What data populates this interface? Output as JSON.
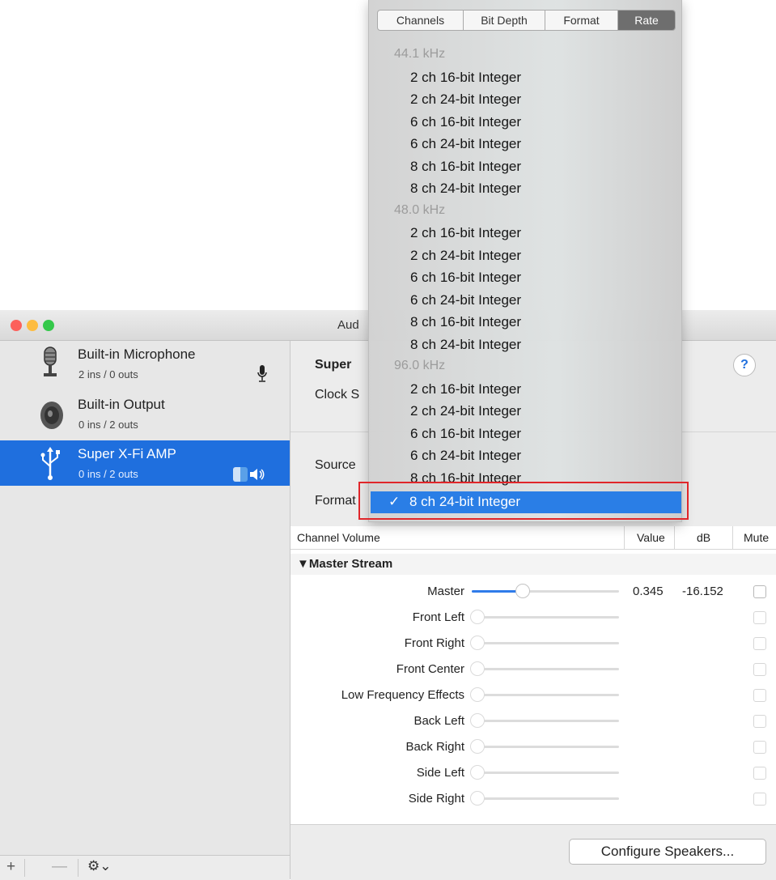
{
  "window": {
    "title": "Aud",
    "traffic_lights": [
      "#fc605b",
      "#fdbc40",
      "#34c84a"
    ]
  },
  "sidebar": {
    "devices": [
      {
        "name": "Built-in Microphone",
        "io": "2 ins / 0 outs",
        "icon": "microphone-icon",
        "badge": "mic-small-icon"
      },
      {
        "name": "Built-in Output",
        "io": "0 ins / 2 outs",
        "icon": "speaker-icon"
      },
      {
        "name": "Super X-Fi AMP",
        "io": "0 ins / 2 outs",
        "icon": "usb-icon",
        "selected": true,
        "badge": "finder-speaker-icon"
      }
    ],
    "footer": {
      "add": "+",
      "remove": "—",
      "gear": "⚙⌄"
    }
  },
  "detail": {
    "device_title": "Super",
    "clock_label": "Clock S",
    "source_label": "Source",
    "format_label": "Format",
    "help": "?"
  },
  "table": {
    "headers": {
      "channel": "Channel Volume",
      "value": "Value",
      "db": "dB",
      "mute": "Mute"
    },
    "group": "▼Master Stream",
    "rows": [
      {
        "label": "Master",
        "value": "0.345",
        "db": "-16.152",
        "level": 0.345,
        "active": true
      },
      {
        "label": "Front Left"
      },
      {
        "label": "Front Right"
      },
      {
        "label": "Front Center"
      },
      {
        "label": "Low Frequency Effects"
      },
      {
        "label": "Back Left"
      },
      {
        "label": "Back Right"
      },
      {
        "label": "Side Left"
      },
      {
        "label": "Side Right"
      }
    ]
  },
  "configure_button": "Configure Speakers...",
  "menu": {
    "tabs": [
      "Channels",
      "Bit Depth",
      "Format",
      "Rate"
    ],
    "active_tab": "Rate",
    "groups": [
      {
        "header": "44.1 kHz",
        "items": [
          "2 ch 16-bit Integer",
          "2 ch 24-bit Integer",
          "6 ch 16-bit Integer",
          "6 ch 24-bit Integer",
          "8 ch 16-bit Integer",
          "8 ch 24-bit Integer"
        ]
      },
      {
        "header": "48.0 kHz",
        "items": [
          "2 ch 16-bit Integer",
          "2 ch 24-bit Integer",
          "6 ch 16-bit Integer",
          "6 ch 24-bit Integer",
          "8 ch 16-bit Integer",
          "8 ch 24-bit Integer"
        ]
      },
      {
        "header": "96.0 kHz",
        "items": [
          "2 ch 16-bit Integer",
          "2 ch 24-bit Integer",
          "6 ch 16-bit Integer",
          "6 ch 24-bit Integer",
          "8 ch 16-bit Integer"
        ]
      }
    ],
    "selected_item": "8 ch 24-bit Integer",
    "check": "✓"
  },
  "colors": {
    "selection": "#1f6fde",
    "highlight_box": "#e0262a"
  }
}
